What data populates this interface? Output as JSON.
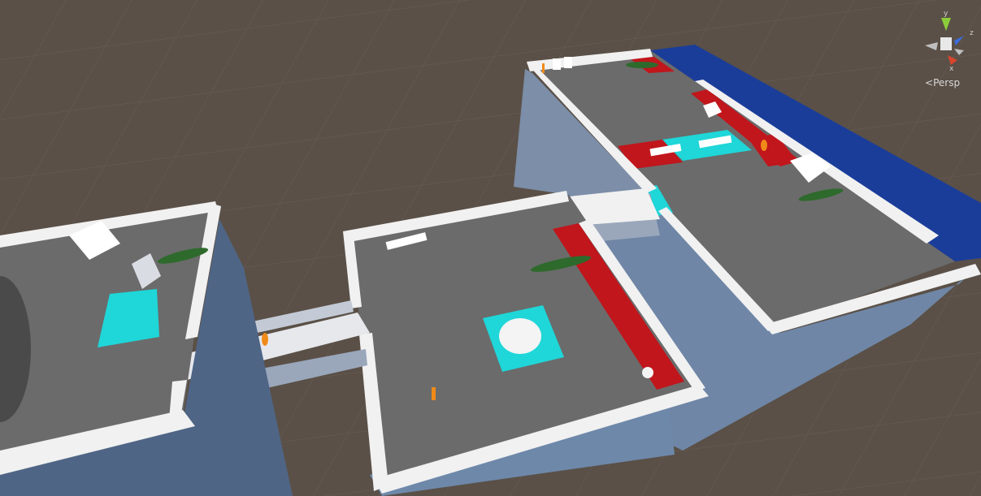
{
  "scene_view": {
    "camera_mode": "Persp",
    "gizmo_axes": [
      "y",
      "z",
      "x"
    ],
    "colors": {
      "ground": "#5a5047",
      "floor": "#6b6b6b",
      "wall": "#f1f1f1",
      "hazard_red": "#c0161c",
      "pad_cyan": "#1fd6d8",
      "water_blue": "#1b3d9a",
      "crocodile": "#2e6a2c",
      "pickup_orange": "#f08a18"
    }
  }
}
